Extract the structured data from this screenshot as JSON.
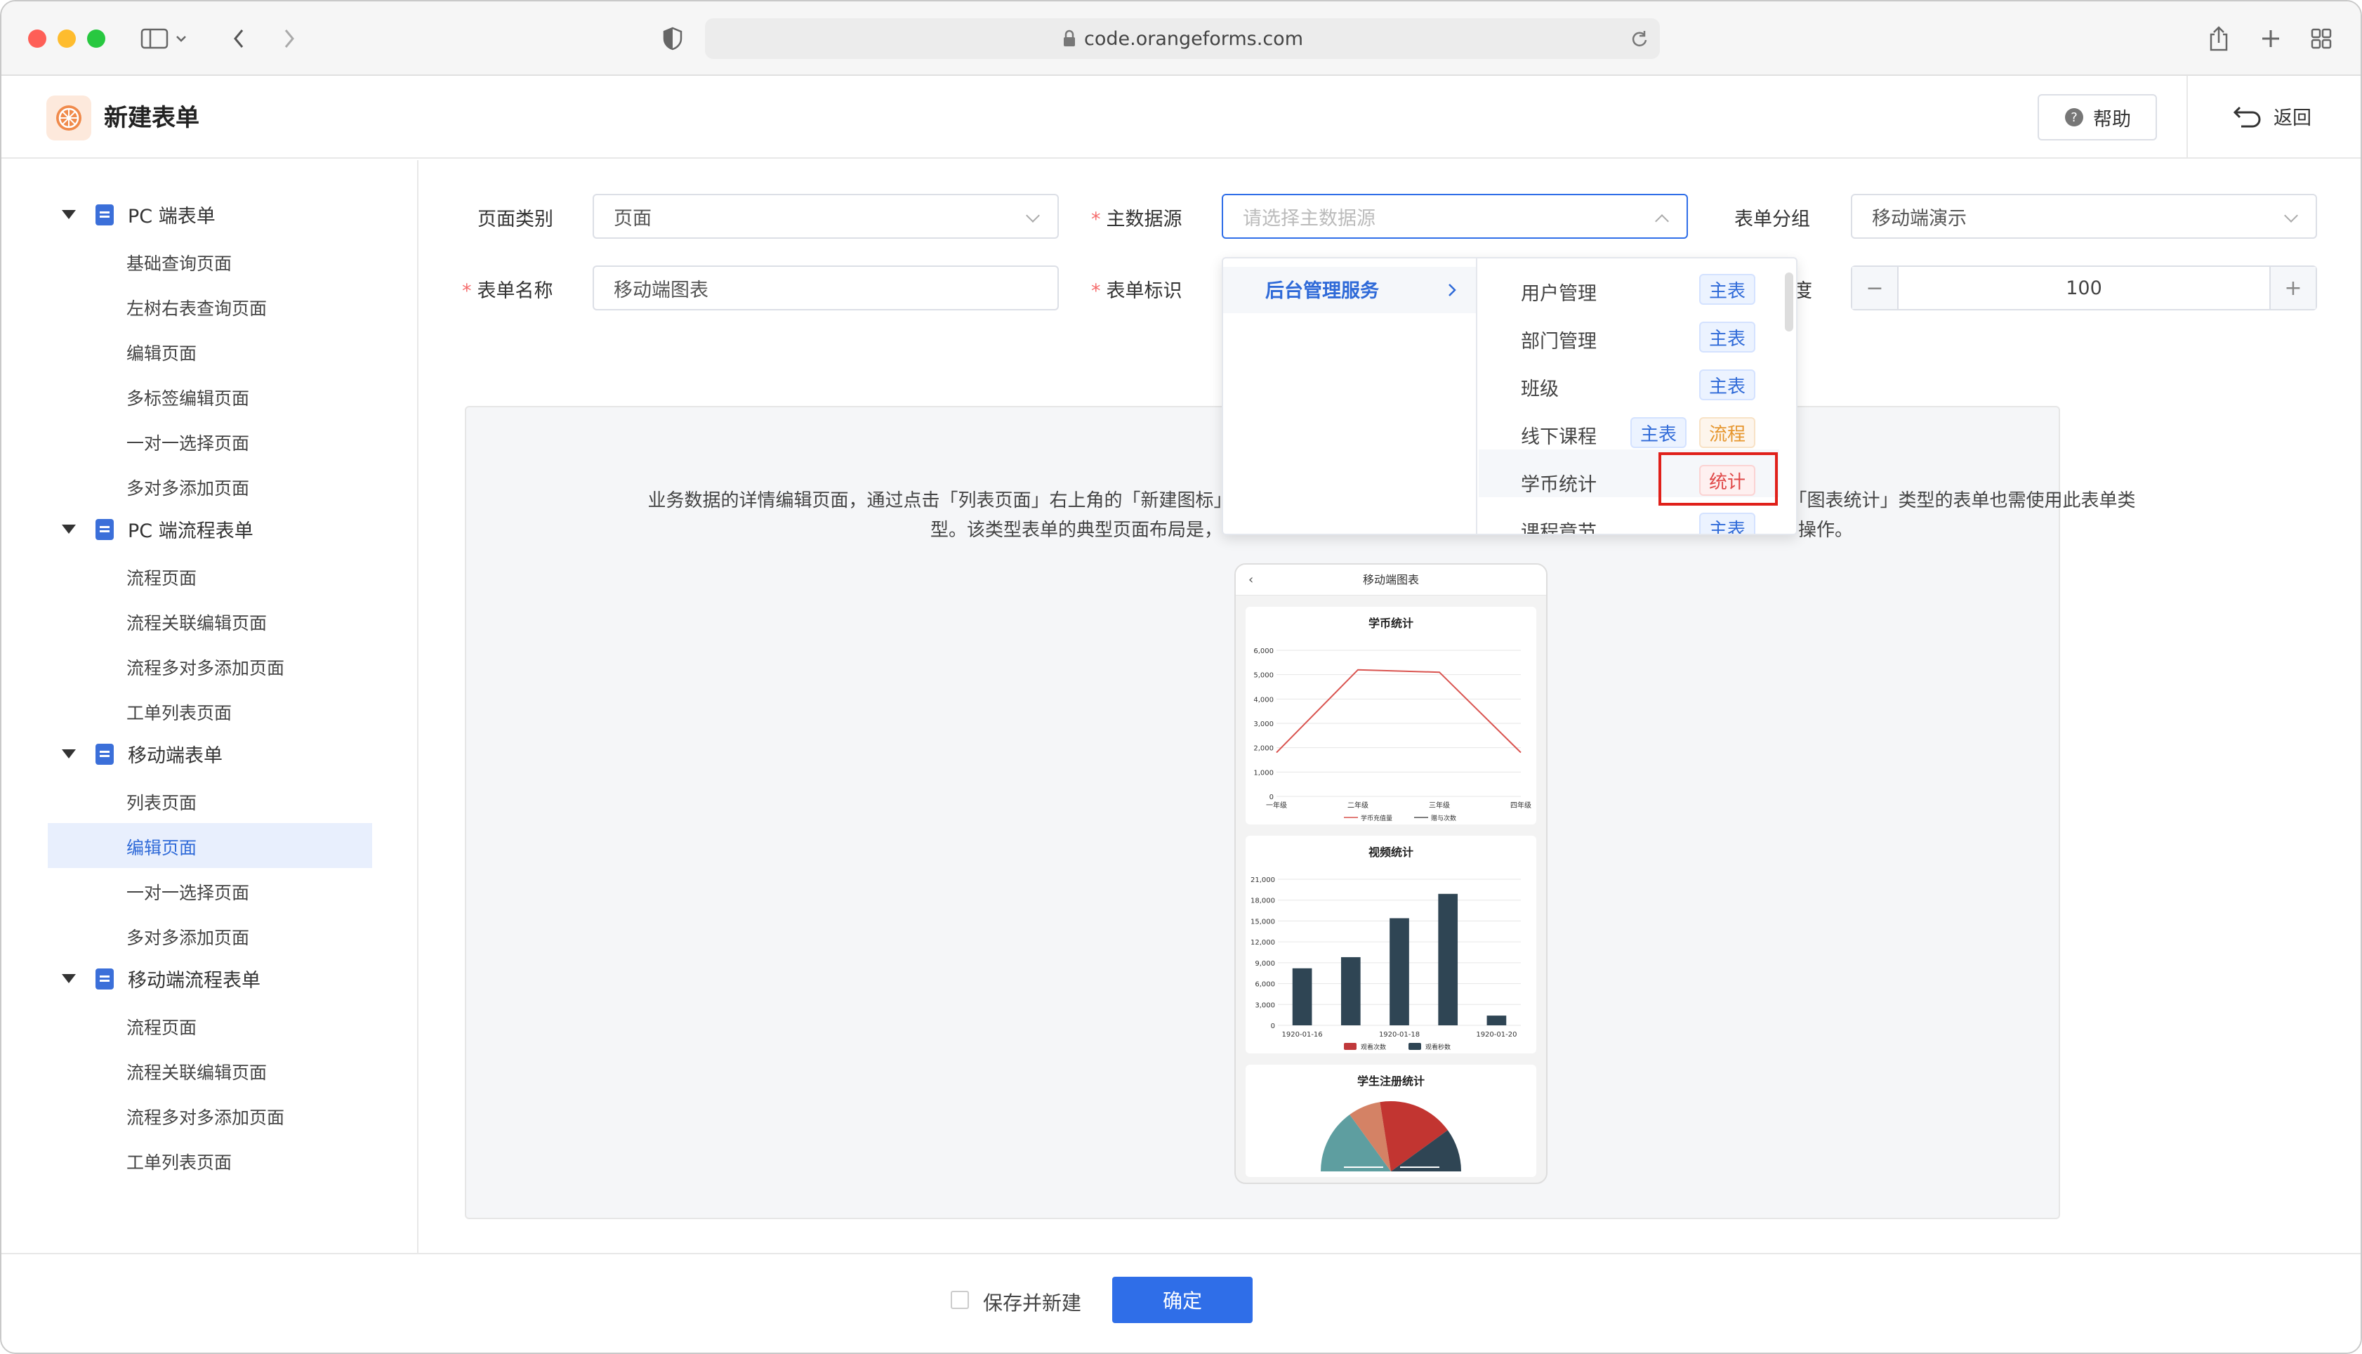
{
  "browser": {
    "url": "code.orangeforms.com"
  },
  "header": {
    "title": "新建表单",
    "help_label": "帮助",
    "back_label": "返回"
  },
  "sidebar": {
    "groups": [
      {
        "label": "PC 端表单",
        "items": [
          "基础查询页面",
          "左树右表查询页面",
          "编辑页面",
          "多标签编辑页面",
          "一对一选择页面",
          "多对多添加页面"
        ]
      },
      {
        "label": "PC 端流程表单",
        "items": [
          "流程页面",
          "流程关联编辑页面",
          "流程多对多添加页面",
          "工单列表页面"
        ]
      },
      {
        "label": "移动端表单",
        "items": [
          "列表页面",
          "编辑页面",
          "一对一选择页面",
          "多对多添加页面"
        ]
      },
      {
        "label": "移动端流程表单",
        "items": [
          "流程页面",
          "流程关联编辑页面",
          "流程多对多添加页面",
          "工单列表页面"
        ]
      }
    ],
    "selected": "编辑页面"
  },
  "form": {
    "page_type_label": "页面类别",
    "page_type_value": "页面",
    "datasource_label": "主数据源",
    "datasource_placeholder": "请选择主数据源",
    "group_label": "表单分组",
    "group_value": "移动端演示",
    "name_label": "表单名称",
    "name_value": "移动端图表",
    "key_label": "表单标识",
    "width_label_partial": "度",
    "width_value": "100",
    "minus": "−",
    "plus": "+"
  },
  "dropdown": {
    "left_item": "后台管理服务",
    "options": [
      {
        "label": "用户管理",
        "tags": [
          "主表"
        ]
      },
      {
        "label": "部门管理",
        "tags": [
          "主表"
        ]
      },
      {
        "label": "班级",
        "tags": [
          "主表"
        ]
      },
      {
        "label": "线下课程",
        "tags": [
          "主表",
          "流程"
        ]
      },
      {
        "label": "学币统计",
        "tags": [
          "统计"
        ]
      },
      {
        "label": "课程章节",
        "tags": [
          "主表"
        ]
      }
    ]
  },
  "description": {
    "line1_left": "业务数据的详情编辑页面，通过点击「列表页面」右上角的「新建图标」",
    "line1_right": "，「图表统计」类型的表单也需使用此表单类",
    "line2_left": "型。该类型表单的典型页面布局是，",
    "line2_right": "操作。"
  },
  "preview": {
    "title": "移动端图表",
    "chart_data": [
      {
        "type": "line",
        "title": "学币统计",
        "categories": [
          "一年级",
          "二年级",
          "三年级",
          "四年级"
        ],
        "ylim": [
          0,
          6000
        ],
        "yticks": [
          "0",
          "1,000",
          "2,000",
          "3,000",
          "4,000",
          "5,000",
          "6,000"
        ],
        "series": [
          {
            "name": "学币充值量",
            "values": [
              1800,
              5200,
              5100,
              1800
            ]
          },
          {
            "name": "赠与次数",
            "values": []
          }
        ],
        "color": "#d9534f"
      },
      {
        "type": "bar",
        "title": "视频统计",
        "categories": [
          "1920-01-16",
          "1920-01-18",
          "1920-01-20"
        ],
        "ylim": [
          0,
          21000
        ],
        "yticks": [
          "0",
          "3,000",
          "6,000",
          "9,000",
          "12,000",
          "15,000",
          "18,000",
          "21,000"
        ],
        "values": [
          8200,
          9800,
          15400,
          18900,
          1400
        ],
        "series": [
          {
            "name": "观看次数",
            "color": "#c0393b"
          },
          {
            "name": "观看秒数",
            "color": "#2f4554"
          }
        ]
      },
      {
        "type": "pie",
        "title": "学生注册统计",
        "colors": [
          "#5e9ea0",
          "#d48265",
          "#c23531",
          "#2f4554"
        ],
        "values": [
          30,
          15,
          35,
          20
        ]
      }
    ]
  },
  "footer": {
    "save_new_label": "保存并新建",
    "confirm_label": "确定"
  }
}
